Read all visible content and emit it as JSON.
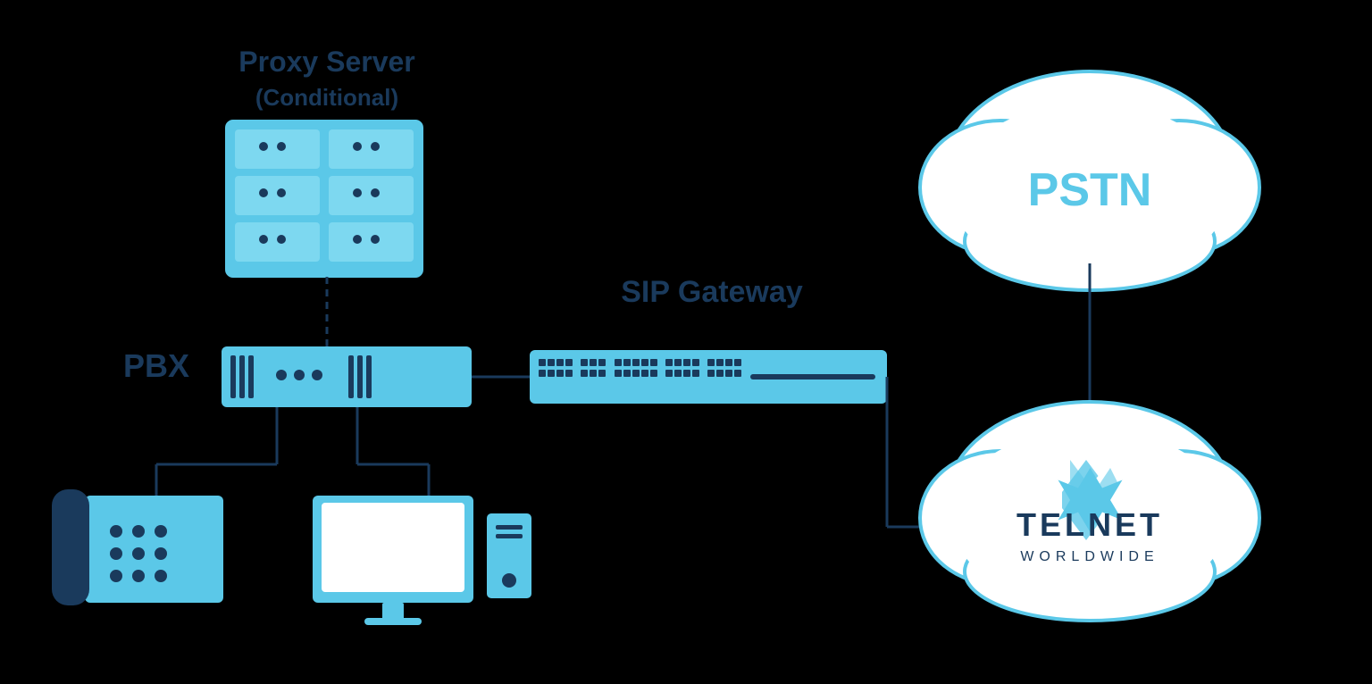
{
  "labels": {
    "proxy_server": "Proxy Server",
    "conditional": "(Conditional)",
    "pbx": "PBX",
    "sip_gateway": "SIP Gateway",
    "pstn": "PSTN",
    "telnet": "TELNET",
    "worldwide": "WORLDWIDE"
  },
  "colors": {
    "background": "#000000",
    "light_blue": "#5bc8e8",
    "dark_blue": "#1a3a5c",
    "mid_blue": "#2e6da4",
    "cloud_bg": "#f0f8ff",
    "line_color": "#1a3a5c",
    "text_dark": "#1a3a5c",
    "text_pstn": "#5bc8e8"
  }
}
